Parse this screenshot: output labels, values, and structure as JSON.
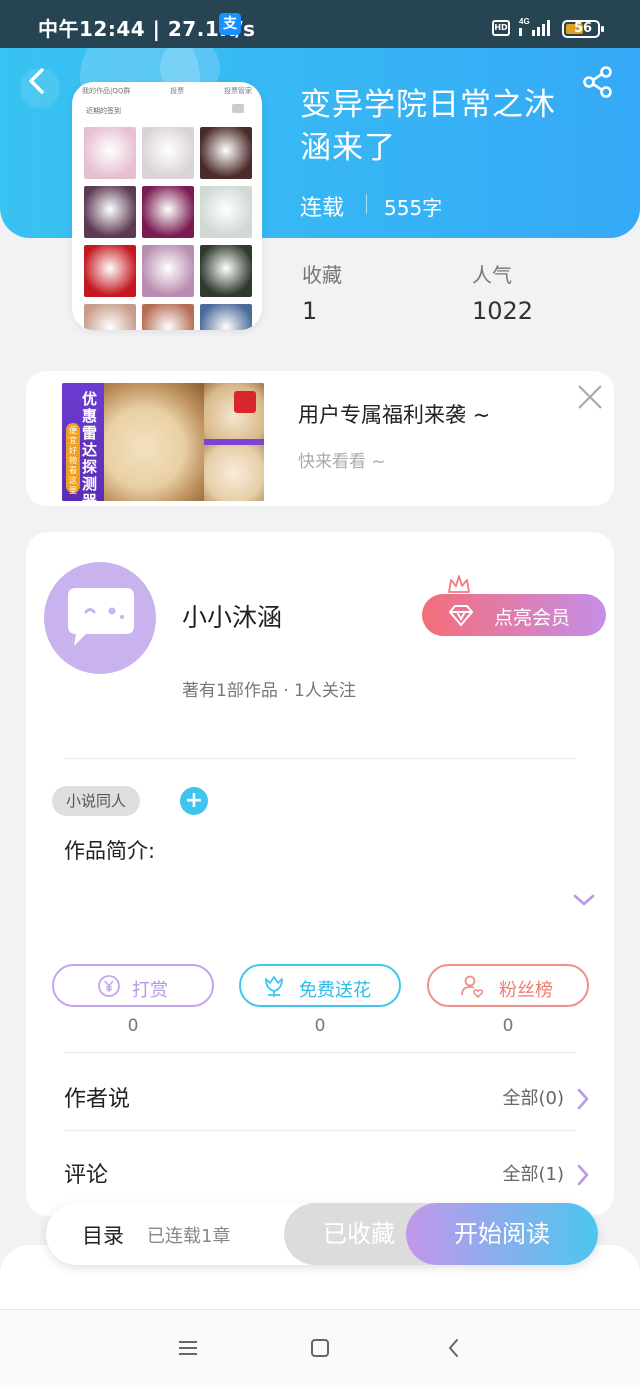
{
  "status_bar": {
    "time": "中午12:44 | 27.1K/s",
    "alipay_icon": "支",
    "hd": "HD",
    "battery": "56",
    "battery_level": 0.56
  },
  "book": {
    "title": "变异学院日常之沐涵来了",
    "status": "连载",
    "word_count": "555字",
    "favorites_label": "收藏",
    "favorites_value": "1",
    "popularity_label": "人气",
    "popularity_value": "1022"
  },
  "cover": {
    "header_left": "我的作品|QQ群",
    "header_mid": "投票",
    "header_right": "投票管家",
    "subtitle": "近期的签到",
    "cell_colors": [
      "#e7bfd2",
      "#d9d3d8",
      "#4a2b2a",
      "#5c3a54",
      "#7a1c52",
      "#cfd8d2",
      "#c41820",
      "#b98db0",
      "#2f3a2c",
      "#c89c8a",
      "#b66d55",
      "#4a6a9a"
    ]
  },
  "ad": {
    "title": "用户专属福利来袭 ~",
    "subtitle": "快来看看 ~",
    "image_text_1": "优惠雷达探测器",
    "image_text_2": "便宜好物看这里"
  },
  "author": {
    "name": "小小沐涵",
    "meta": "著有1部作品 · 1人关注",
    "vip_button": "点亮会员"
  },
  "tags": {
    "tag1": "小说同人",
    "add": "+"
  },
  "intro": {
    "label": "作品简介:"
  },
  "actions": [
    {
      "label": "打赏",
      "count": "0"
    },
    {
      "label": "免费送花",
      "count": "0"
    },
    {
      "label": "粉丝榜",
      "count": "0"
    }
  ],
  "rows": {
    "author_says": {
      "label": "作者说",
      "right": "全部(0)"
    },
    "comments": {
      "label": "评论",
      "right": "全部(1)"
    }
  },
  "bottom_bar": {
    "catalog": "目录",
    "chapters": "已连载1章",
    "collected": "已收藏",
    "start_reading": "开始阅读"
  },
  "colors": {
    "header_start": "#39c3f1",
    "header_end": "#35a9f7",
    "reward": "#c5a5ea",
    "flower": "#41c7ec",
    "fans": "#f09088"
  }
}
